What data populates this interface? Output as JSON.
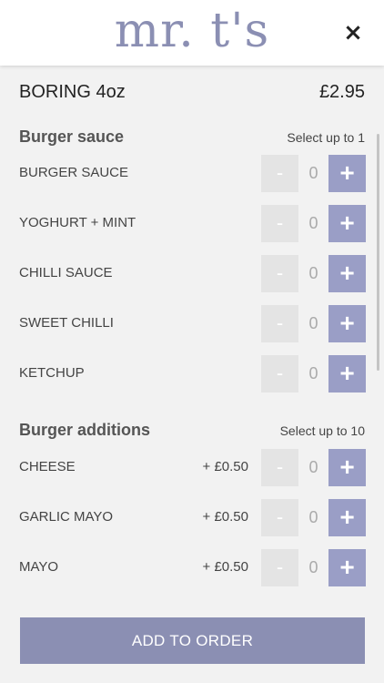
{
  "header": {
    "logo_text": "mr. t's",
    "close_icon": "×"
  },
  "item": {
    "name": "BORING 4oz",
    "price": "£2.95"
  },
  "sections": [
    {
      "title": "Burger sauce",
      "limit": "Select up to 1",
      "options": [
        {
          "label": "BURGER SAUCE",
          "price": "",
          "qty": "0"
        },
        {
          "label": "YOGHURT + MINT",
          "price": "",
          "qty": "0"
        },
        {
          "label": "CHILLI SAUCE",
          "price": "",
          "qty": "0"
        },
        {
          "label": "SWEET CHILLI",
          "price": "",
          "qty": "0"
        },
        {
          "label": "KETCHUP",
          "price": "",
          "qty": "0"
        }
      ]
    },
    {
      "title": "Burger additions",
      "limit": "Select up to 10",
      "options": [
        {
          "label": "CHEESE",
          "price": "+ £0.50",
          "qty": "0"
        },
        {
          "label": "GARLIC MAYO",
          "price": "+ £0.50",
          "qty": "0"
        },
        {
          "label": "MAYO",
          "price": "+ £0.50",
          "qty": "0"
        }
      ]
    }
  ],
  "controls": {
    "minus": "-",
    "plus": "+"
  },
  "add_button": "ADD TO ORDER",
  "colors": {
    "accent": "#9a9ec6",
    "button": "#8b8fb3",
    "minus_bg": "#e4e4e4"
  }
}
